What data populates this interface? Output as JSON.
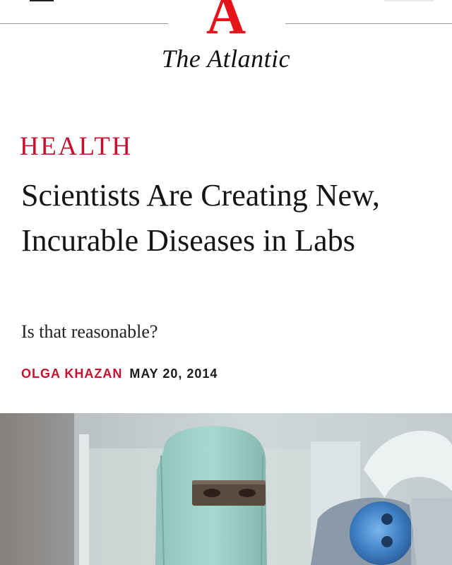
{
  "header": {
    "logo_letter": "A",
    "wordmark": "The Atlantic"
  },
  "article": {
    "section": "HEALTH",
    "title": "Scientists Are Creating New, Incurable Diseases in Labs",
    "dek": "Is that reasonable?",
    "author": "OLGA KHAZAN",
    "date": "MAY 20, 2014"
  },
  "icons": {
    "menu": "hamburger-menu-icon"
  },
  "colors": {
    "brand_red": "#e7131a",
    "section_red": "#c8102e",
    "text": "#151515",
    "rule": "#9a9a9a"
  }
}
